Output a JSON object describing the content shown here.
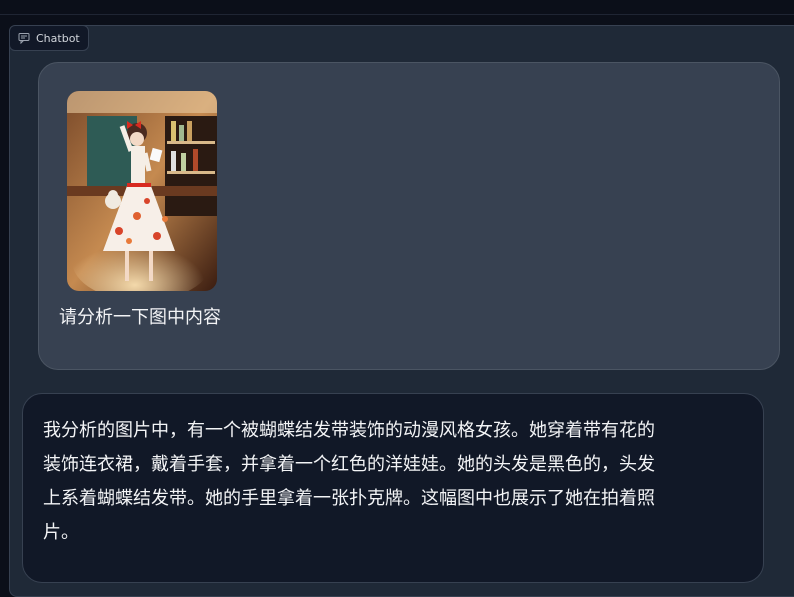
{
  "panel": {
    "label": "Chatbot",
    "label_icon": "chat-icon"
  },
  "messages": {
    "user": {
      "image_alt": "anime-girl-photo",
      "text": "请分析一下图中内容"
    },
    "bot": {
      "text": "我分析的图片中，有一个被蝴蝶结发带装饰的动漫风格女孩。她穿着带有花的\n装饰连衣裙，戴着手套，并拿着一个红色的洋娃娃。她的头发是黑色的，头发\n上系着蝴蝶结发带。她的手里拿着一张扑克牌。这幅图中也展示了她在拍着照\n片。"
    }
  }
}
